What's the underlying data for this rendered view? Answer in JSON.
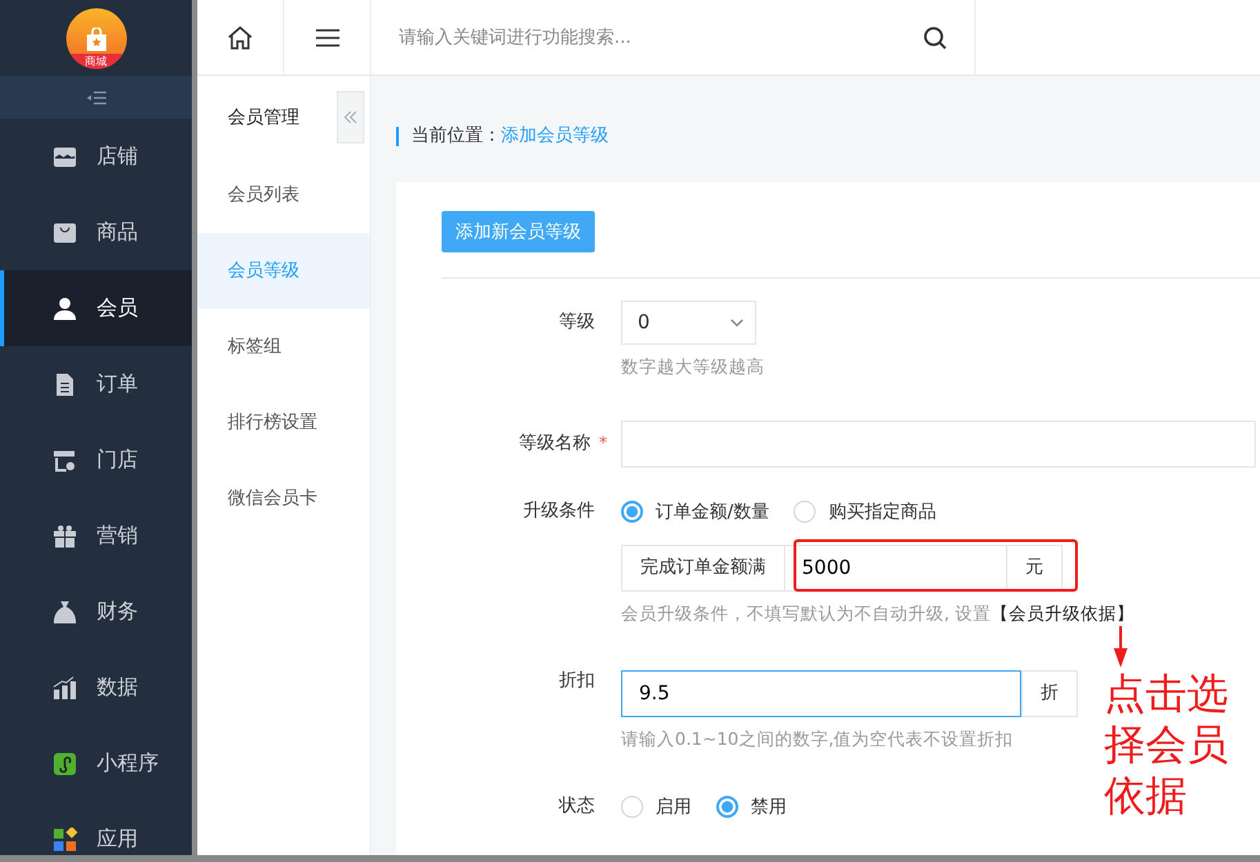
{
  "logo": {
    "text": "商城"
  },
  "nav": [
    {
      "label": "店铺",
      "kind": "shop",
      "selected": false
    },
    {
      "label": "商品",
      "kind": "bag",
      "selected": false
    },
    {
      "label": "会员",
      "kind": "user",
      "selected": true
    },
    {
      "label": "订单",
      "kind": "doc",
      "selected": false
    },
    {
      "label": "门店",
      "kind": "store",
      "selected": false
    },
    {
      "label": "营销",
      "kind": "gift",
      "selected": false
    },
    {
      "label": "财务",
      "kind": "money",
      "selected": false
    },
    {
      "label": "数据",
      "kind": "chart",
      "selected": false
    },
    {
      "label": "小程序",
      "kind": "mini",
      "selected": false
    },
    {
      "label": "应用",
      "kind": "apps",
      "selected": false
    }
  ],
  "subnav": {
    "title": "会员管理",
    "items": [
      {
        "label": "会员列表",
        "selected": false
      },
      {
        "label": "会员等级",
        "selected": true
      },
      {
        "label": "标签组",
        "selected": false
      },
      {
        "label": "排行榜设置",
        "selected": false
      },
      {
        "label": "微信会员卡",
        "selected": false
      }
    ]
  },
  "search": {
    "placeholder": "请输入关键词进行功能搜索..."
  },
  "breadcrumb": {
    "label": "当前位置：",
    "current": "添加会员等级"
  },
  "tab_button": "添加新会员等级",
  "form": {
    "level": {
      "label": "等级",
      "value": "0",
      "hint": "数字越大等级越高"
    },
    "name": {
      "label": "等级名称",
      "required_mark": "*"
    },
    "upgrade": {
      "label": "升级条件",
      "options": [
        {
          "label": "订单金额/数量",
          "selected": true
        },
        {
          "label": "购买指定商品",
          "selected": false
        }
      ],
      "prefix": "完成订单金额满",
      "value": "5000",
      "suffix": "元",
      "hint": "会员升级条件，不填写默认为不自动升级, 设置",
      "link": "【会员升级依据】"
    },
    "discount": {
      "label": "折扣",
      "value": "9.5",
      "suffix": "折",
      "hint": "请输入0.1~10之间的数字,值为空代表不设置折扣"
    },
    "status": {
      "label": "状态",
      "options": [
        {
          "label": "启用",
          "selected": false
        },
        {
          "label": "禁用",
          "selected": true
        }
      ]
    }
  },
  "annotation": {
    "text": "点击选择会员依据"
  }
}
